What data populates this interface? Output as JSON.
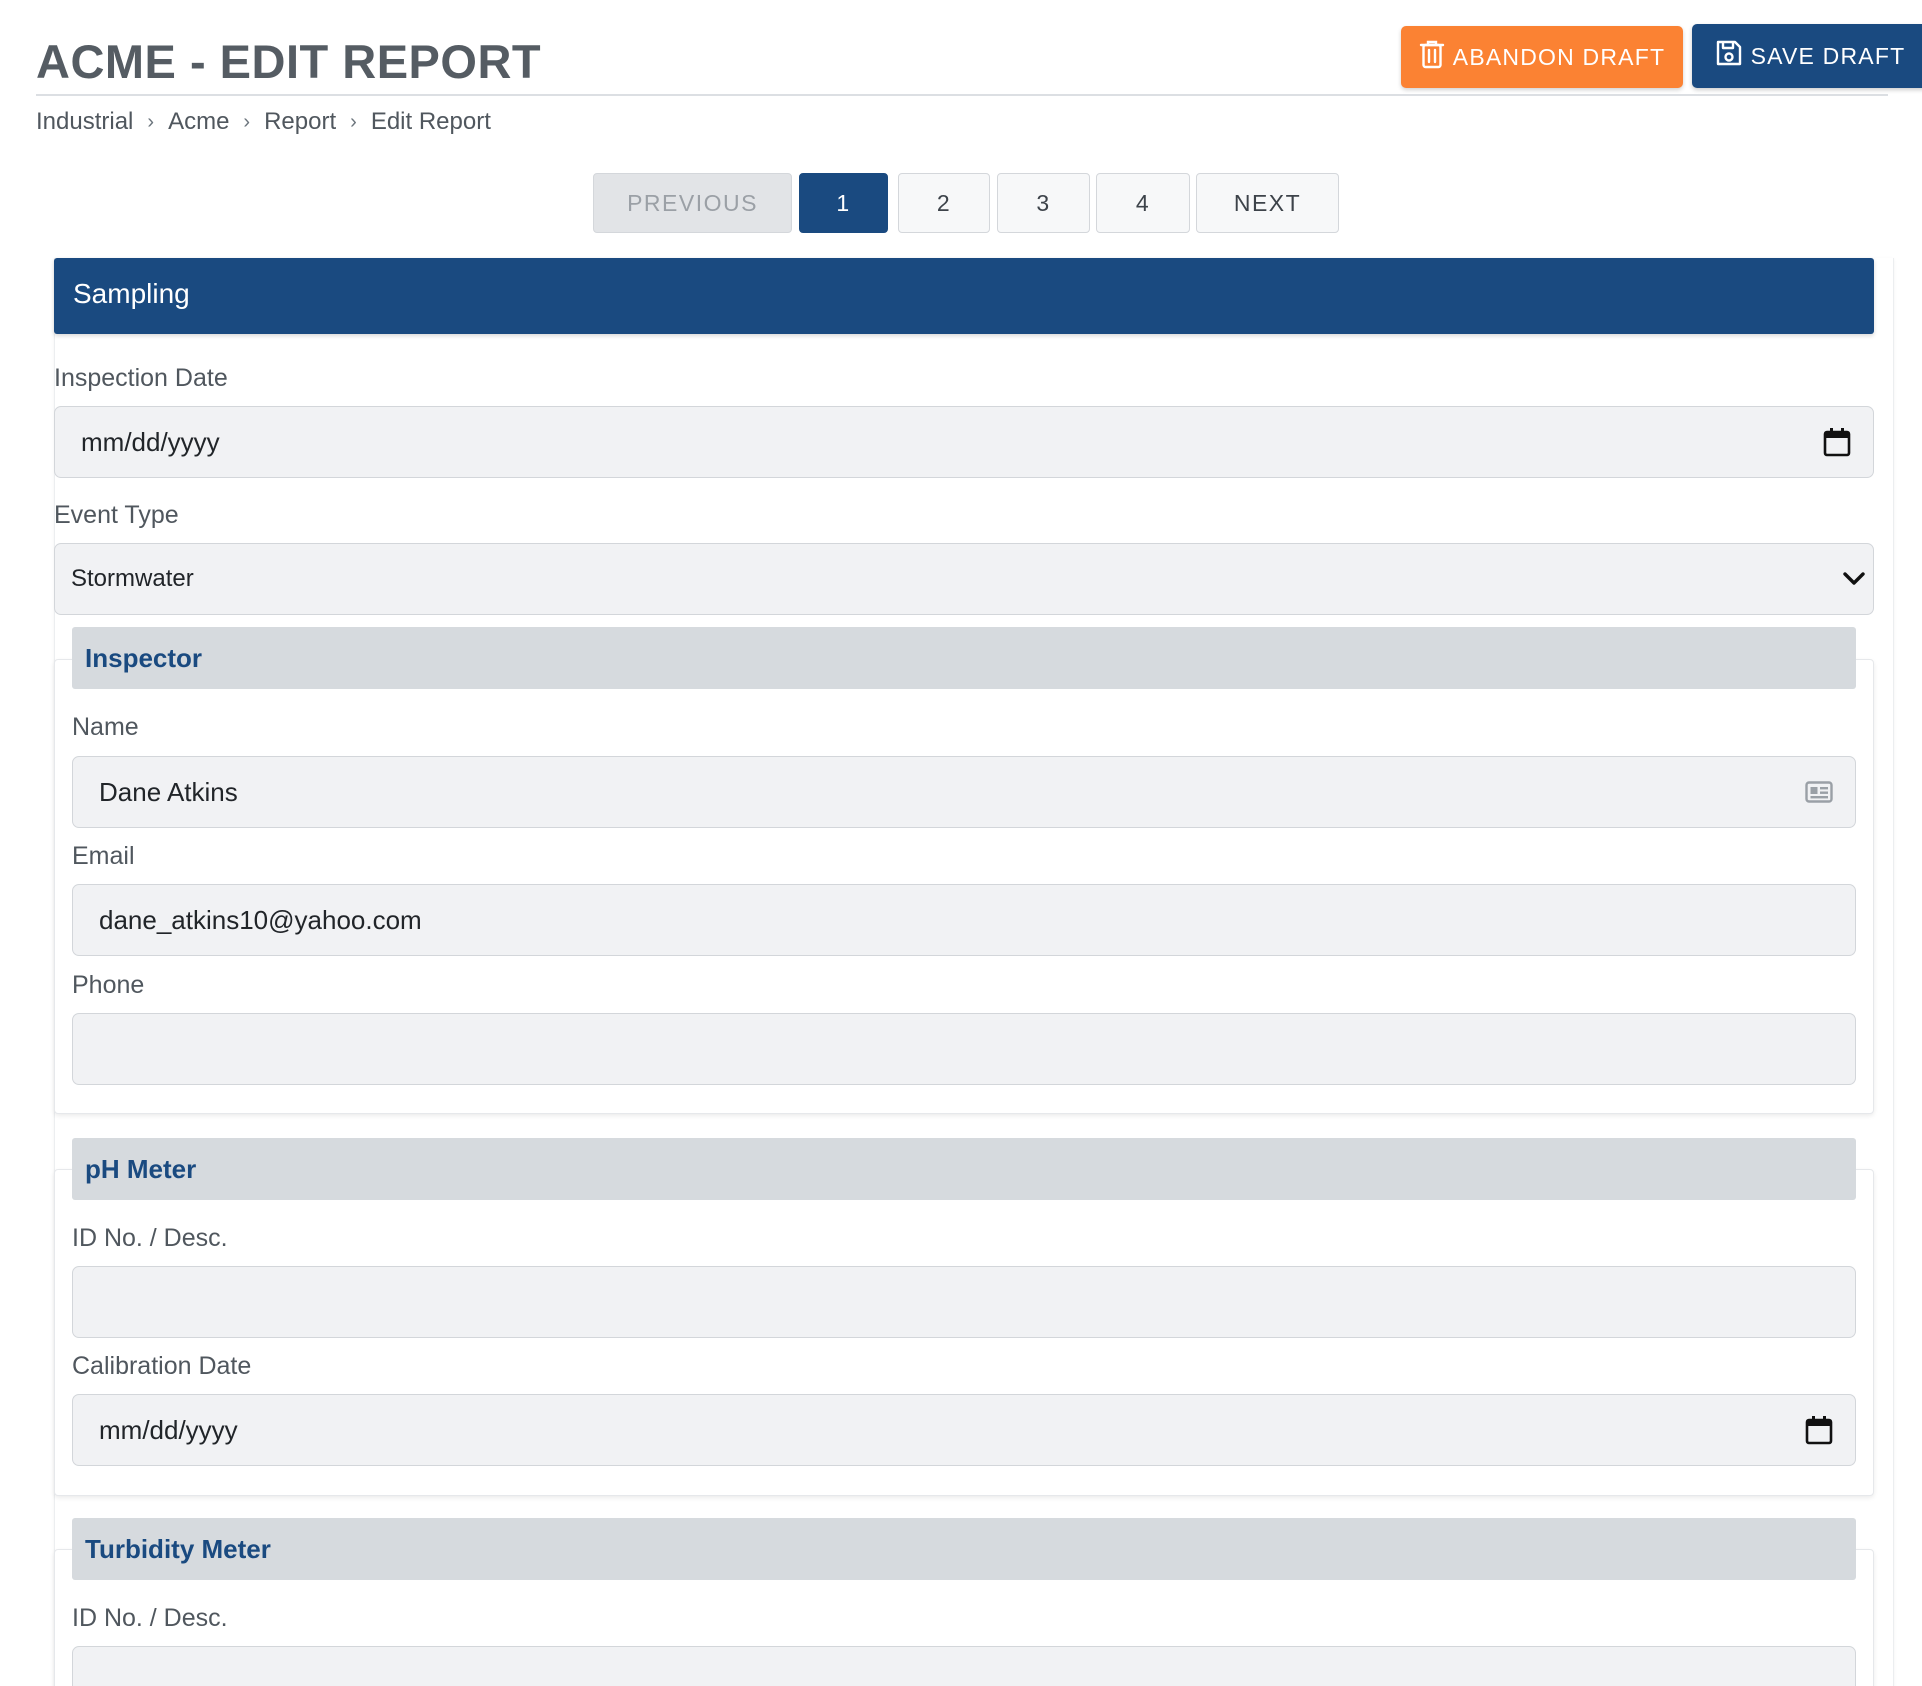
{
  "header": {
    "title": "ACME - EDIT REPORT",
    "abandon_label": "ABANDON DRAFT",
    "save_label": "SAVE DRAFT",
    "abandon_icon": "trash-icon",
    "save_icon": "floppy-disk-icon",
    "abandon_color": "#fb8233",
    "save_color": "#1a4a80"
  },
  "breadcrumb": {
    "items": [
      "Industrial",
      "Acme",
      "Report",
      "Edit Report"
    ],
    "separator": "›"
  },
  "pagination": {
    "previous": "PREVIOUS",
    "pages": [
      "1",
      "2",
      "3",
      "4"
    ],
    "next": "NEXT",
    "active_page": "1"
  },
  "section": {
    "title": "Sampling",
    "inspection_date_label": "Inspection Date",
    "inspection_date_value": "mm/dd/yyyy",
    "event_type_label": "Event Type",
    "event_type_value": "Stormwater"
  },
  "inspector": {
    "title": "Inspector",
    "name_label": "Name",
    "name_value": "Dane Atkins",
    "email_label": "Email",
    "email_value": "dane_atkins10@yahoo.com",
    "phone_label": "Phone",
    "phone_value": ""
  },
  "ph_meter": {
    "title": "pH Meter",
    "id_label": "ID No. / Desc.",
    "id_value": "",
    "calibration_label": "Calibration Date",
    "calibration_value": "mm/dd/yyyy"
  },
  "turbidity_meter": {
    "title": "Turbidity Meter",
    "id_label": "ID No. / Desc.",
    "id_value": ""
  }
}
